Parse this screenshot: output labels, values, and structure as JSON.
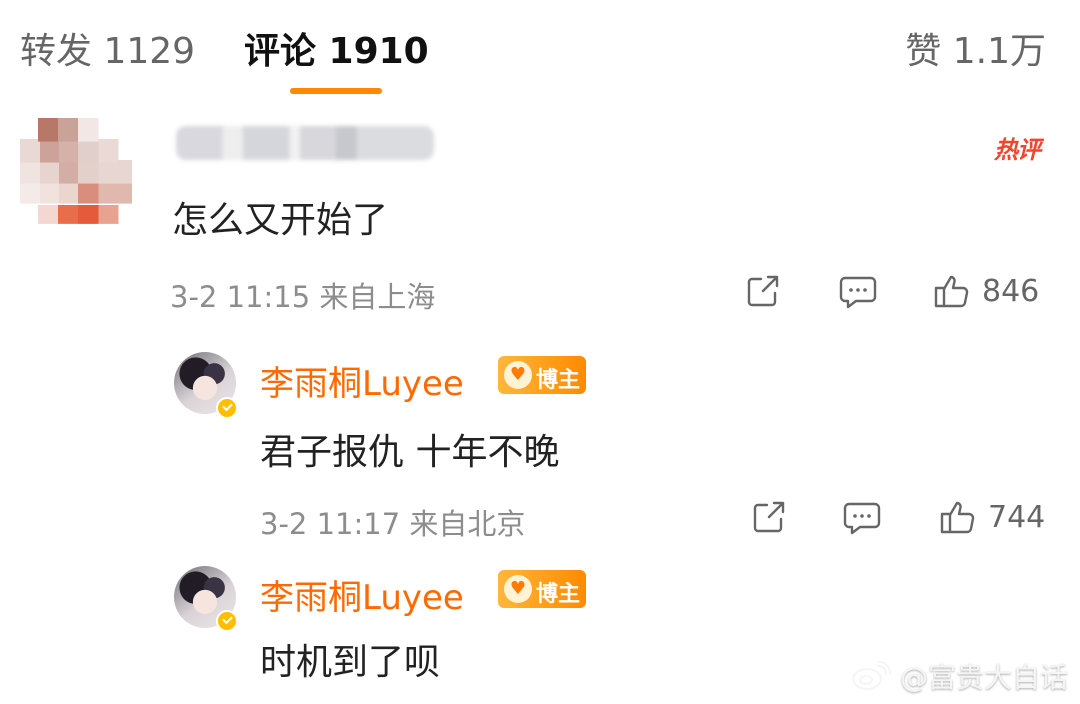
{
  "tabs": {
    "repost": "转发 1129",
    "comments": "评论 1910",
    "likes": "赞 1.1万"
  },
  "comment": {
    "badge": "热评",
    "text": "怎么又开始了",
    "meta": "3-2 11:15 来自上海",
    "like_count": "846"
  },
  "replies": [
    {
      "name": "李雨桐Luyee",
      "badge": "博主",
      "text": "君子报仇 十年不晚",
      "meta": "3-2 11:17 来自北京",
      "like_count": "744"
    },
    {
      "name": "李雨桐Luyee",
      "badge": "博主",
      "text": "时机到了呗"
    }
  ],
  "watermark": "@富贵大自话",
  "colors": {
    "accent": "#ff8a00",
    "username": "#ff6a00",
    "hot_badge": "#f2452f"
  }
}
